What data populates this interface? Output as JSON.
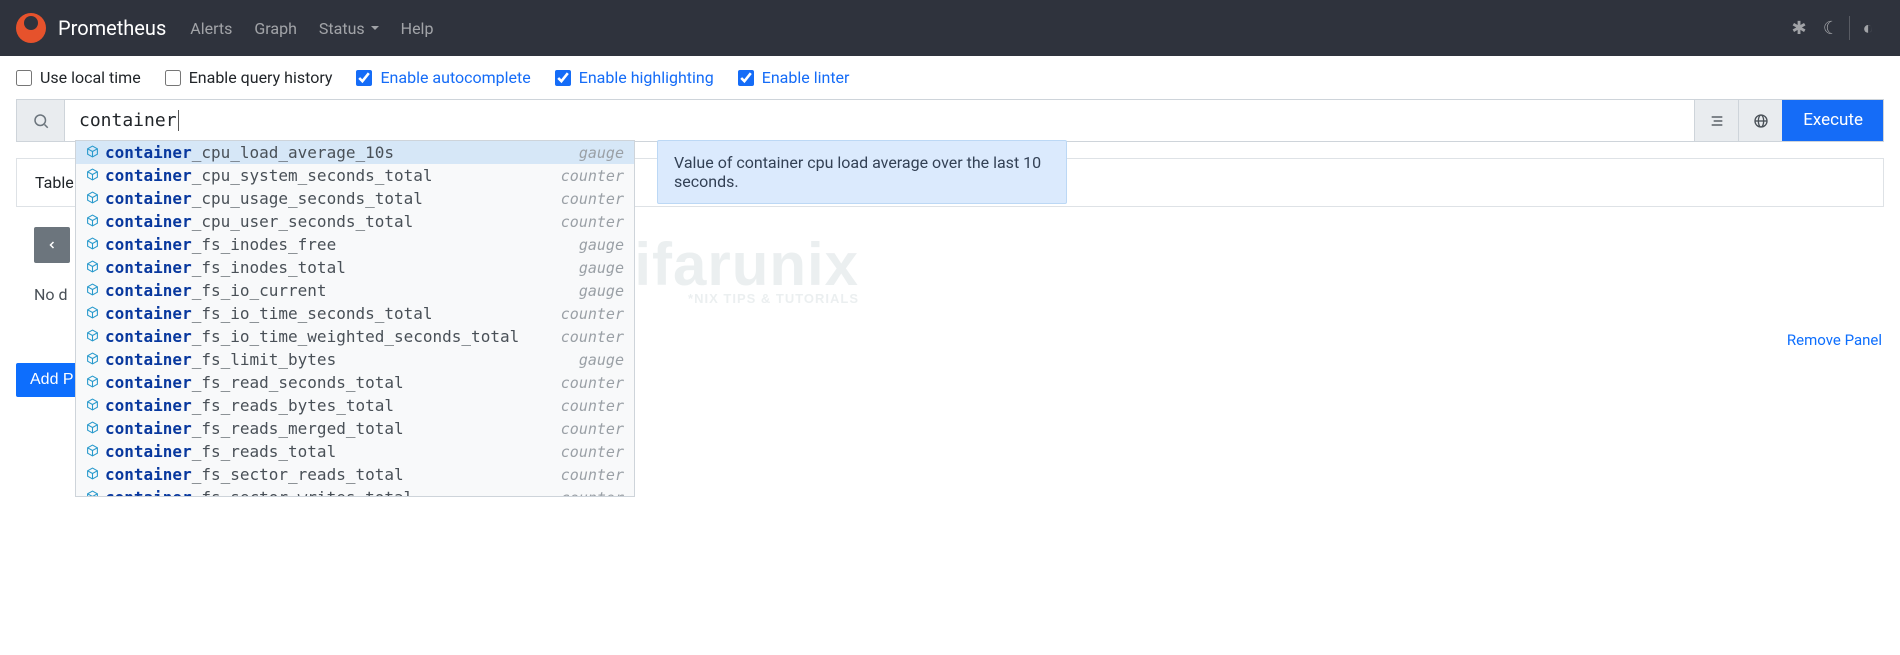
{
  "brand": {
    "name": "Prometheus"
  },
  "nav": {
    "items": [
      {
        "label": "Alerts"
      },
      {
        "label": "Graph"
      },
      {
        "label": "Status",
        "dropdown": true
      },
      {
        "label": "Help"
      }
    ]
  },
  "options": [
    {
      "label": "Use local time",
      "checked": false
    },
    {
      "label": "Enable query history",
      "checked": false
    },
    {
      "label": "Enable autocomplete",
      "checked": true
    },
    {
      "label": "Enable highlighting",
      "checked": true
    },
    {
      "label": "Enable linter",
      "checked": true
    }
  ],
  "query": {
    "value": "container",
    "execute_label": "Execute"
  },
  "autocomplete": {
    "match_prefix": "container",
    "items": [
      {
        "rest": "_cpu_load_average_10s",
        "type": "gauge",
        "selected": true,
        "desc": "Value of container cpu load average over the last 10 seconds."
      },
      {
        "rest": "_cpu_system_seconds_total",
        "type": "counter"
      },
      {
        "rest": "_cpu_usage_seconds_total",
        "type": "counter"
      },
      {
        "rest": "_cpu_user_seconds_total",
        "type": "counter"
      },
      {
        "rest": "_fs_inodes_free",
        "type": "gauge"
      },
      {
        "rest": "_fs_inodes_total",
        "type": "gauge"
      },
      {
        "rest": "_fs_io_current",
        "type": "gauge"
      },
      {
        "rest": "_fs_io_time_seconds_total",
        "type": "counter"
      },
      {
        "rest": "_fs_io_time_weighted_seconds_total",
        "type": "counter"
      },
      {
        "rest": "_fs_limit_bytes",
        "type": "gauge"
      },
      {
        "rest": "_fs_read_seconds_total",
        "type": "counter"
      },
      {
        "rest": "_fs_reads_bytes_total",
        "type": "counter"
      },
      {
        "rest": "_fs_reads_merged_total",
        "type": "counter"
      },
      {
        "rest": "_fs_reads_total",
        "type": "counter"
      },
      {
        "rest": "_fs_sector_reads_total",
        "type": "counter"
      },
      {
        "rest": "_fs_sector_writes_total",
        "type": "counter"
      }
    ]
  },
  "tooltip": {
    "text": "Value of container cpu load average over the last 10 seconds."
  },
  "tabs": {
    "table_label": "Table"
  },
  "paging": {
    "no_data_label": "No d"
  },
  "remove_panel_label": "Remove Panel",
  "add_panel_label": "Add P",
  "watermark": {
    "big": "Kifarunix",
    "small": "*NIX TIPS & TUTORIALS"
  }
}
